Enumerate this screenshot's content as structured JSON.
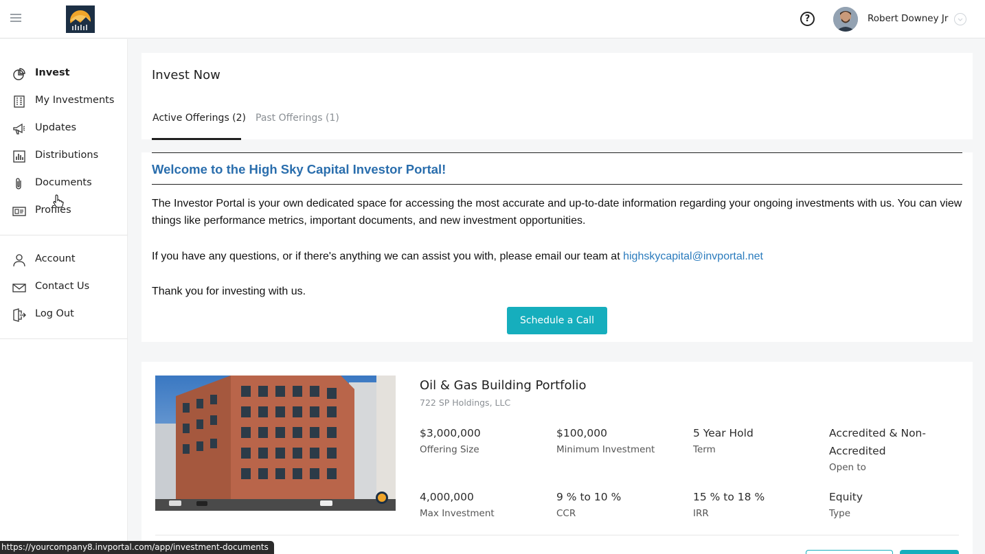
{
  "header": {
    "help_glyph": "?",
    "user_name": "Robert Downey Jr"
  },
  "sidebar": {
    "items": [
      {
        "label": "Invest",
        "icon": "pie-chart-icon",
        "active": true
      },
      {
        "label": "My Investments",
        "icon": "building-icon"
      },
      {
        "label": "Updates",
        "icon": "megaphone-icon"
      },
      {
        "label": "Distributions",
        "icon": "bar-chart-icon"
      },
      {
        "label": "Documents",
        "icon": "paperclip-icon"
      },
      {
        "label": "Profiles",
        "icon": "id-card-icon"
      }
    ],
    "account_items": [
      {
        "label": "Account",
        "icon": "user-icon"
      },
      {
        "label": "Contact Us",
        "icon": "envelope-icon"
      },
      {
        "label": "Log Out",
        "icon": "logout-icon"
      }
    ]
  },
  "main": {
    "title": "Invest Now",
    "tabs": [
      {
        "label": "Active Offerings (2)",
        "active": true
      },
      {
        "label": "Past Offerings (1)",
        "active": false
      }
    ]
  },
  "welcome": {
    "title": "Welcome to the High Sky Capital Investor Portal!",
    "para1_line1": "The Investor Portal is your own dedicated space for accessing the most accurate and up-to-date information regarding your ongoing investments with us. You can view",
    "para1_line2": "things like performance metrics, important documents, and new investment opportunities.",
    "para2_prefix": "If you have any questions, or if there's anything we can assist you with, please email our team at ",
    "email": "highskycapital@invportal.net",
    "para3": "Thank you for investing with us.",
    "cta_label": "Schedule a Call"
  },
  "offering": {
    "title": "Oil & Gas Building Portfolio",
    "sponsor": "722 SP Holdings, LLC",
    "stats": [
      {
        "value": "$3,000,000",
        "label": "Offering Size"
      },
      {
        "value": "$100,000",
        "label": "Minimum Investment"
      },
      {
        "value": "5 Year Hold",
        "label": "Term"
      },
      {
        "value_line1": "Accredited & Non-",
        "value_line2": "Accredited",
        "label": "Open to"
      },
      {
        "value": "4,000,000",
        "label": "Max Investment"
      },
      {
        "value": "9 % to 10 %",
        "label": "CCR"
      },
      {
        "value": "15 % to 18 %",
        "label": "IRR"
      },
      {
        "value": "Equity",
        "label": "Type"
      }
    ]
  },
  "statusbar": {
    "url": "https://yourcompany8.invportal.com/app/investment-documents"
  },
  "colors": {
    "accent": "#16aebd",
    "welcome_title": "#2a6ead",
    "link": "#2a7bbd"
  }
}
